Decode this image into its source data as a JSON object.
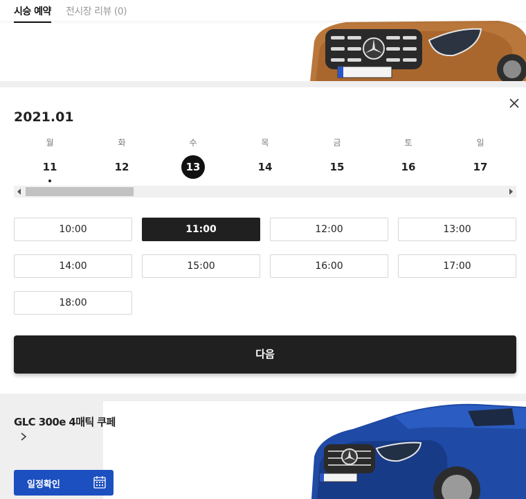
{
  "tabs": {
    "active": "시승 예약",
    "inactive": "전시장 리뷰 (0)"
  },
  "calendar": {
    "month": "2021.01",
    "days": [
      {
        "dow": "월",
        "num": "11",
        "selected": false,
        "dot": true
      },
      {
        "dow": "화",
        "num": "12",
        "selected": false,
        "dot": false
      },
      {
        "dow": "수",
        "num": "13",
        "selected": true,
        "dot": false
      },
      {
        "dow": "목",
        "num": "14",
        "selected": false,
        "dot": false
      },
      {
        "dow": "금",
        "num": "15",
        "selected": false,
        "dot": false
      },
      {
        "dow": "토",
        "num": "16",
        "selected": false,
        "dot": false
      },
      {
        "dow": "일",
        "num": "17",
        "selected": false,
        "dot": false
      }
    ]
  },
  "times": [
    {
      "label": "10:00",
      "selected": false
    },
    {
      "label": "11:00",
      "selected": true
    },
    {
      "label": "12:00",
      "selected": false
    },
    {
      "label": "13:00",
      "selected": false
    },
    {
      "label": "14:00",
      "selected": false
    },
    {
      "label": "15:00",
      "selected": false
    },
    {
      "label": "16:00",
      "selected": false
    },
    {
      "label": "17:00",
      "selected": false
    },
    {
      "label": "18:00",
      "selected": false
    }
  ],
  "next_label": "다음",
  "bottom": {
    "model": "GLC 300e 4매틱 쿠페",
    "schedule_label": "일정확인"
  },
  "colors": {
    "accent_dark": "#202020",
    "button_blue": "#1c4fbf",
    "car_top": "#b9773b",
    "car_bottom": "#1f4aa6"
  },
  "icons": {
    "close": "close-icon",
    "chevron": "chevron-right-icon",
    "calendar": "calendar-icon"
  }
}
